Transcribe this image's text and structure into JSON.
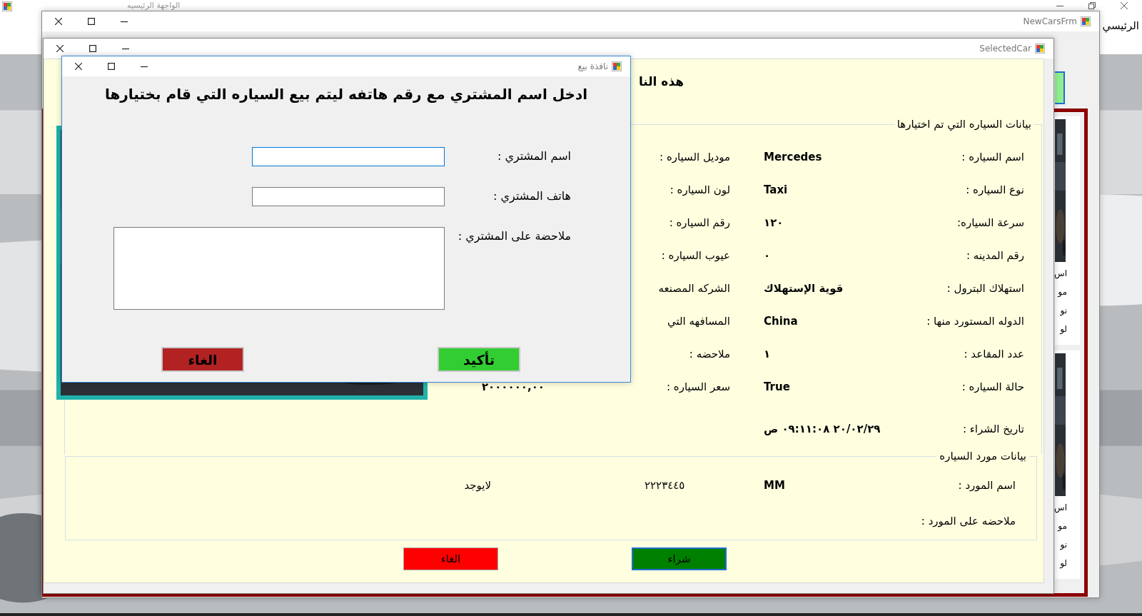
{
  "main_window": {
    "title": "الواجهة الرئيسيه",
    "menu_item": "الرئيسي"
  },
  "cars_window": {
    "title": "NewCarsFrm",
    "cards": [
      {
        "lines": [
          "اس",
          "مو",
          "نو",
          "لو"
        ]
      },
      {
        "lines": [
          "اس",
          "مو",
          "نو",
          "لو"
        ]
      }
    ]
  },
  "selected_car_window": {
    "title": "SelectedCar",
    "heading": "هذه النا",
    "car_group": {
      "legend": "بيانات السياره التي تم اختيارها",
      "rows": [
        {
          "label": "اسم السياره :",
          "value": "Mercedes",
          "label_2": "موديل السياره :"
        },
        {
          "label": "نوع السياره :",
          "value": "Taxi",
          "label_2": "لون السياره :"
        },
        {
          "label": "سرعة السياره:",
          "value": "١٢٠",
          "label_2": "رقم السياره :"
        },
        {
          "label": "رقم المدينه :",
          "value": "٠",
          "label_2": "عيوب السياره :"
        },
        {
          "label": "استهلاك البترول :",
          "value": "قوية الإستهلاك",
          "label_2": "الشركه المصنعه"
        },
        {
          "label": "الدوله المستورد منها :",
          "value": "China",
          "label_2": "المسافهه التي"
        },
        {
          "label": "عدد المقاعد :",
          "value": "١",
          "label_2": "ملاحضه :"
        },
        {
          "label": "حالة السياره :",
          "value": "True",
          "label_2": "سعر السياره :",
          "value_2": "٢٠٠٠٠٠٠,٠٠"
        },
        {
          "label": "تاريخ الشراء :",
          "value": "٢٠/٠٢/٢٩ ٠٩:١١:٠٨ ص"
        }
      ]
    },
    "supplier_group": {
      "legend": "بيانات مورد السياره",
      "rows": [
        {
          "label": "اسم المورد :",
          "values": [
            "MM",
            "٢٢٢٣٤٤٥",
            "لايوجد"
          ]
        },
        {
          "label": "ملاحضه على المورد :"
        }
      ]
    },
    "buttons": [
      {
        "label": "شراء",
        "kind": "buy"
      },
      {
        "label": "الغاء",
        "kind": "cancel"
      }
    ]
  },
  "sale_dialog": {
    "title": "نافذة بيع",
    "heading": "ادخل اسم المشتري مع رقم هاتفه ليتم بيع السياره التي قام بختيارها",
    "fields": [
      {
        "label": "اسم المشتري :",
        "kind": "line",
        "focused": true
      },
      {
        "label": "هاتف المشتري :",
        "kind": "line",
        "focused": false
      },
      {
        "label": "ملاحضة على المشتري :",
        "kind": "multiline",
        "focused": false
      }
    ],
    "buttons": [
      {
        "label": "تأكيد",
        "kind": "confirm"
      },
      {
        "label": "الغاء",
        "kind": "cancel"
      }
    ]
  }
}
